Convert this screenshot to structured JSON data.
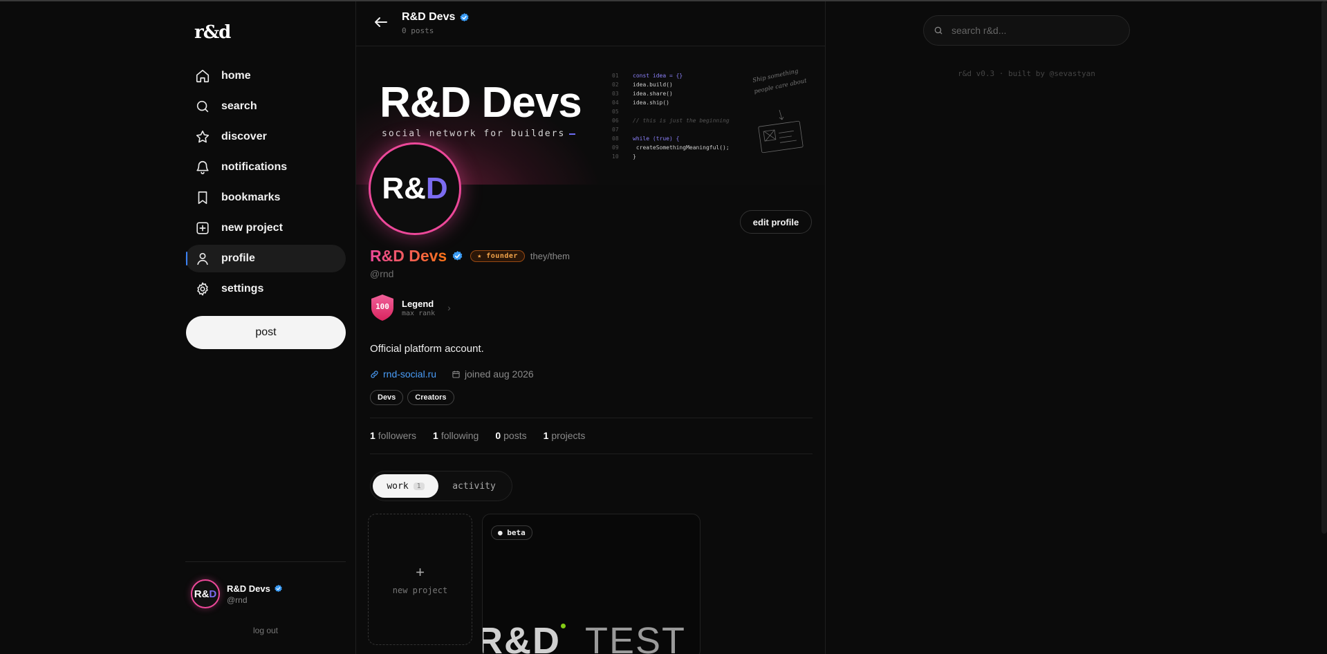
{
  "app": {
    "logo": "r&d"
  },
  "nav": {
    "items": [
      {
        "label": "home",
        "icon": "home-icon"
      },
      {
        "label": "search",
        "icon": "search-icon"
      },
      {
        "label": "discover",
        "icon": "star-icon"
      },
      {
        "label": "notifications",
        "icon": "bell-icon"
      },
      {
        "label": "bookmarks",
        "icon": "bookmark-icon"
      },
      {
        "label": "new project",
        "icon": "plus-square-icon"
      },
      {
        "label": "profile",
        "icon": "user-icon",
        "active": true
      },
      {
        "label": "settings",
        "icon": "gear-icon"
      }
    ],
    "post_label": "post"
  },
  "sidebar_user": {
    "avatar_text": "R&",
    "avatar_accent": "D",
    "name": "R&D Devs",
    "handle": "@rnd",
    "logout_label": "log out"
  },
  "header": {
    "title": "R&D Devs",
    "subtitle": "0 posts"
  },
  "banner": {
    "title": "R&D Devs",
    "subtitle": "social network for builders",
    "code_lines": [
      {
        "n": "01",
        "t": "const idea = {}"
      },
      {
        "n": "02",
        "t": "idea.build()"
      },
      {
        "n": "03",
        "t": "idea.share()"
      },
      {
        "n": "04",
        "t": "idea.ship()"
      },
      {
        "n": "05",
        "t": ""
      },
      {
        "n": "06",
        "t": "// this is just the beginning"
      },
      {
        "n": "07",
        "t": ""
      },
      {
        "n": "08",
        "t": "while (true) {"
      },
      {
        "n": "09",
        "t": "  createSomethingMeaningful();"
      },
      {
        "n": "10",
        "t": "}"
      }
    ],
    "sketch_text_1": "Ship something",
    "sketch_text_2": "people care about"
  },
  "profile": {
    "avatar_text": "R&",
    "avatar_accent": "D",
    "name": "R&D Devs",
    "badge": "★ founder",
    "pronouns": "they/them",
    "handle": "@rnd",
    "edit_label": "edit profile",
    "rank": {
      "level": "100",
      "title": "Legend",
      "subtitle": "max rank"
    },
    "bio": "Official platform account.",
    "website": "rnd-social.ru",
    "joined": "joined aug 2026",
    "tags": [
      "Devs",
      "Creators"
    ],
    "stats": [
      {
        "value": "1",
        "label": "followers"
      },
      {
        "value": "1",
        "label": "following"
      },
      {
        "value": "0",
        "label": "posts"
      },
      {
        "value": "1",
        "label": "projects"
      }
    ]
  },
  "tabs": [
    {
      "label": "work",
      "count": "1",
      "active": true
    },
    {
      "label": "activity"
    }
  ],
  "projects": {
    "new_label": "new project",
    "new_plus": "+",
    "card": {
      "badge": "● beta",
      "art_left": "R&D",
      "art_right": "TEST"
    }
  },
  "right": {
    "search_placeholder": "search r&d...",
    "footer": "r&d v0.3 · built by @sevastyan"
  },
  "colors": {
    "accent_blue": "#3b82f6",
    "link": "#4a9df8",
    "pink": "#ec4899",
    "orange": "#f97316",
    "purple": "#7c6cf0",
    "founder": "#f5a54a"
  }
}
